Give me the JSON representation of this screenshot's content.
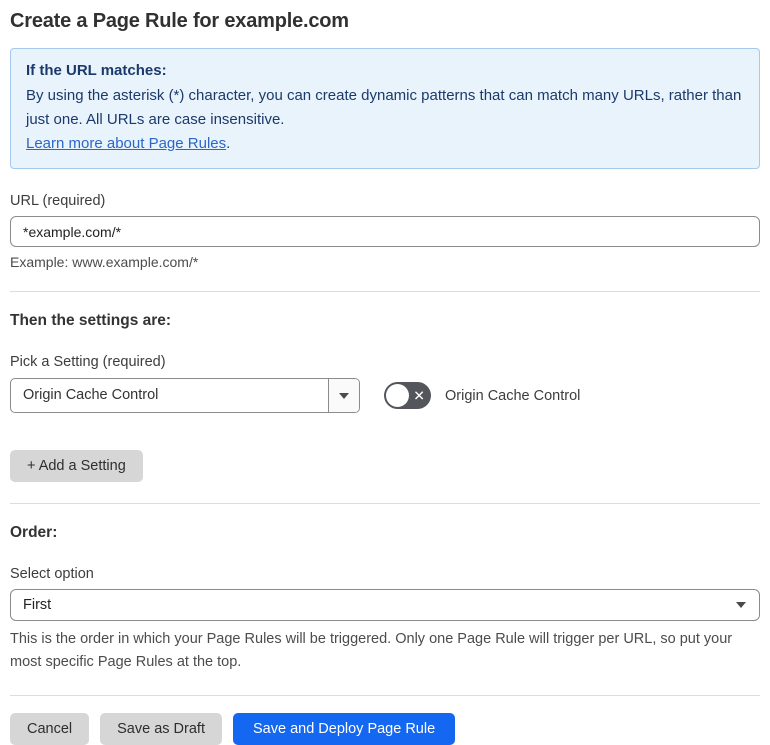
{
  "page": {
    "title": "Create a Page Rule for example.com"
  },
  "info_box": {
    "heading": "If the URL matches:",
    "body": "By using the asterisk (*) character, you can create dynamic patterns that can match many URLs, rather than just one. All URLs are case insensitive.",
    "link_label": "Learn more about Page Rules",
    "link_suffix": "."
  },
  "url_section": {
    "label": "URL (required)",
    "value": "*example.com/*",
    "example": "Example: www.example.com/*"
  },
  "settings_section": {
    "heading": "Then the settings are:",
    "pick_label": "Pick a Setting (required)",
    "selected_setting": "Origin Cache Control",
    "toggle_label": "Origin Cache Control",
    "toggle_state": "off",
    "toggle_off_glyph": "✕",
    "add_setting_label": "+ Add a Setting"
  },
  "order_section": {
    "heading": "Order:",
    "label": "Select option",
    "selected_option": "First",
    "help_text": "This is the order in which your Page Rules will be triggered. Only one Page Rule will trigger per URL, so put your most specific Page Rules at the top."
  },
  "footer": {
    "cancel_label": "Cancel",
    "save_draft_label": "Save as Draft",
    "save_deploy_label": "Save and Deploy Page Rule"
  },
  "colors": {
    "accent_blue": "#1467f0",
    "info_bg": "#e9f3fc",
    "info_border": "#a5c9ec",
    "info_text": "#1b3a6b",
    "link_blue": "#2a67c9",
    "toggle_off_bg": "#53575c",
    "button_gray": "#d6d6d6"
  }
}
